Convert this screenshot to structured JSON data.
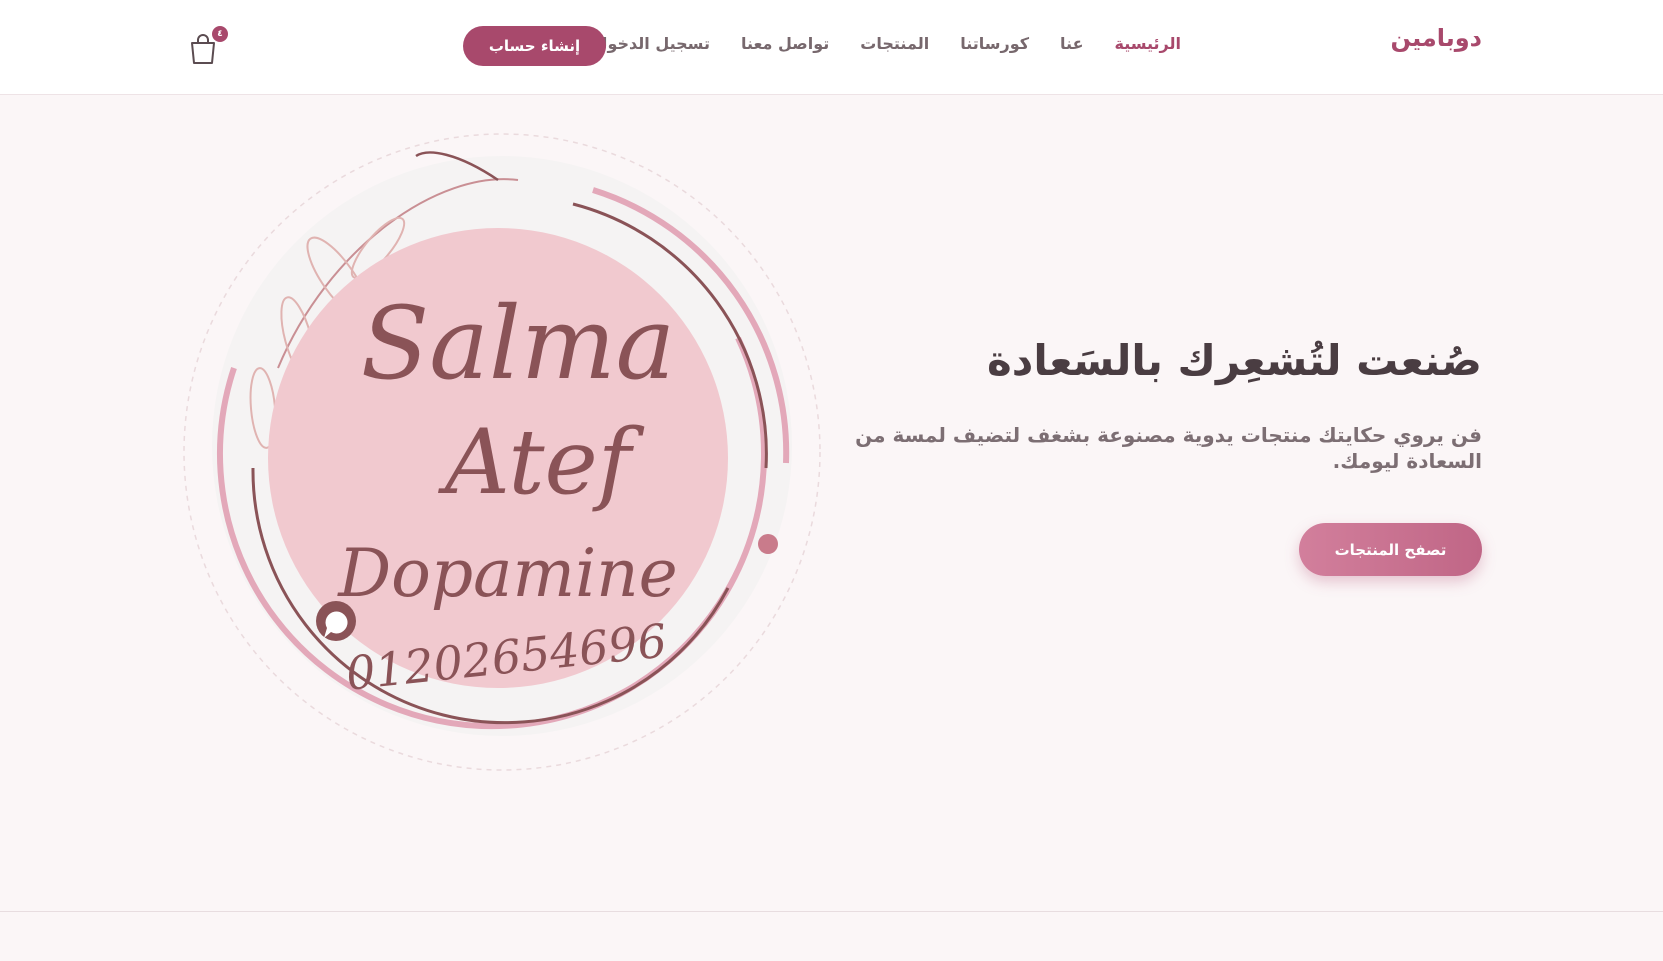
{
  "header": {
    "brand": "دوبامين",
    "nav": [
      {
        "label": "الرئيسية",
        "active": true
      },
      {
        "label": "عنا"
      },
      {
        "label": "كورساتنا"
      },
      {
        "label": "المنتجات"
      },
      {
        "label": "تواصل معنا"
      },
      {
        "label": "تسجيل الدخول"
      }
    ],
    "register_label": "إنشاء حساب",
    "cart_icon": "shopping-bag-icon",
    "cart_count": "٤"
  },
  "logo": {
    "line1": "Salma",
    "line2": "Atef",
    "line3": "Dopamine",
    "phone": "01202654696",
    "whatsapp_icon": "whatsapp-icon"
  },
  "hero": {
    "title": "صُنعت لتُشعِرك بالسَعادة",
    "subtitle": "فن يروي حكايتك منتجات يدوية مصنوعة بشغف لتضيف لمسة من السعادة ليومك.",
    "cta_label": "تصفح المنتجات"
  },
  "colors": {
    "accent": "#a8496c",
    "text_dark": "#4a3d42",
    "text_muted": "#77686d",
    "background": "#fbf6f7",
    "logo_pink": "#f1c9cf",
    "logo_brown": "#8a5357"
  }
}
